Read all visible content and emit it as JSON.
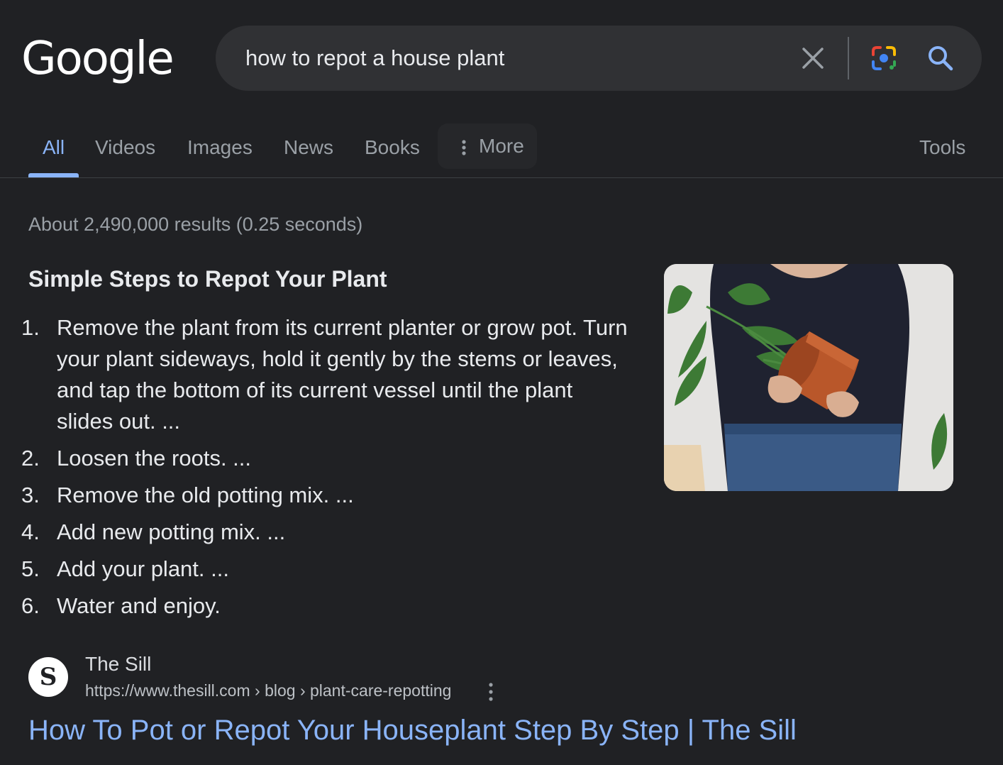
{
  "logo": {
    "text": "Google"
  },
  "search": {
    "query": "how to repot a house plant",
    "clear_icon": "close-icon",
    "lens_icon": "google-lens-icon",
    "submit_icon": "search-icon"
  },
  "tabs": [
    {
      "label": "All",
      "active": true
    },
    {
      "label": "Videos"
    },
    {
      "label": "Images"
    },
    {
      "label": "News"
    },
    {
      "label": "Books"
    }
  ],
  "more_label": "More",
  "tools_label": "Tools",
  "result_stats": "About 2,490,000 results (0.25 seconds)",
  "snippet": {
    "title": "Simple Steps to Repot Your Plant",
    "steps": [
      {
        "num": "1.",
        "text": "Remove the plant from its current planter or grow pot. Turn your plant sideways, hold it gently by the stems or leaves, and tap the bottom of its current vessel until the plant slides out. ..."
      },
      {
        "num": "2.",
        "text": "Loosen the roots. ..."
      },
      {
        "num": "3.",
        "text": "Remove the old potting mix. ..."
      },
      {
        "num": "4.",
        "text": "Add new potting mix. ..."
      },
      {
        "num": "5.",
        "text": "Add your plant. ..."
      },
      {
        "num": "6.",
        "text": "Water and enjoy."
      }
    ]
  },
  "source": {
    "favicon_letter": "S",
    "site_name": "The Sill",
    "url": "https://www.thesill.com › blog › plant-care-repotting",
    "title": "How To Pot or Repot Your Houseplant Step By Step | The Sill"
  },
  "colors": {
    "background": "#202124",
    "link": "#8ab4f8",
    "muted": "#9aa0a6"
  }
}
